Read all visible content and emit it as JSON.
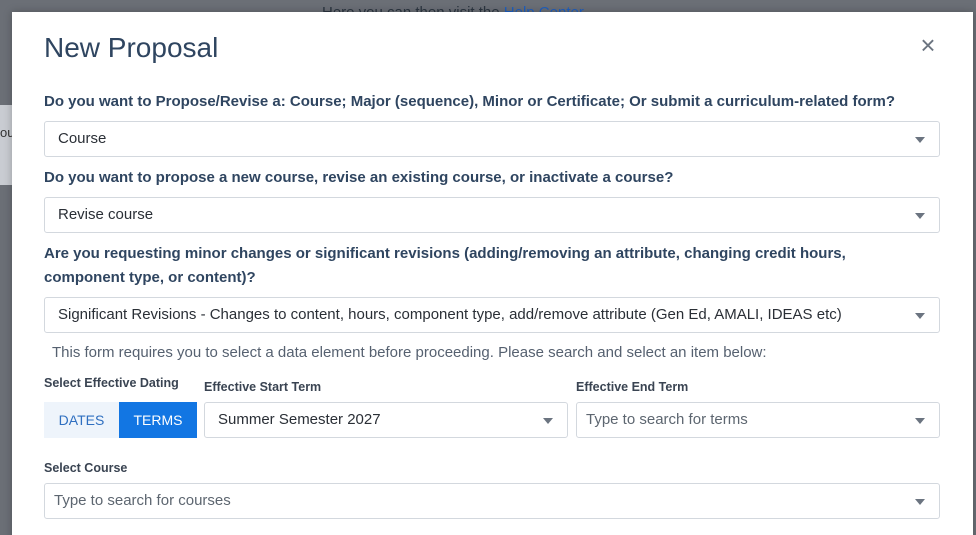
{
  "backdrop": {
    "text_prefix": "Here you can then visit the",
    "link_text": "Help Center",
    "card_text": "ou"
  },
  "modal": {
    "title": "New Proposal",
    "close_glyph": "×"
  },
  "questions": {
    "q1": {
      "label": "Do you want to Propose/Revise a: Course; Major (sequence), Minor or Certificate; Or submit a curriculum-related form?",
      "value": "Course"
    },
    "q2": {
      "label": "Do you want to propose a new course, revise an existing course, or inactivate a course?",
      "value": "Revise course"
    },
    "q3": {
      "label": "Are you requesting minor changes or significant revisions (adding/removing an attribute, changing credit hours, component type, or content)?",
      "value": "Significant Revisions - Changes to content, hours, component type, add/remove attribute (Gen Ed, AMALI, IDEAS etc)"
    }
  },
  "info_text": "This form requires you to select a data element before proceeding. Please search and select an item below:",
  "effective_dating": {
    "label": "Select Effective Dating",
    "dates_label": "DATES",
    "terms_label": "TERMS",
    "start_term_label": "Effective Start Term",
    "start_term_value": "Summer Semester 2027",
    "end_term_label": "Effective End Term",
    "end_term_placeholder": "Type to search for terms"
  },
  "course": {
    "label": "Select Course",
    "placeholder": "Type to search for courses"
  },
  "colors": {
    "title": "#2f4560",
    "accent": "#1276e3",
    "toggle_inactive_bg": "#eef4fb"
  }
}
